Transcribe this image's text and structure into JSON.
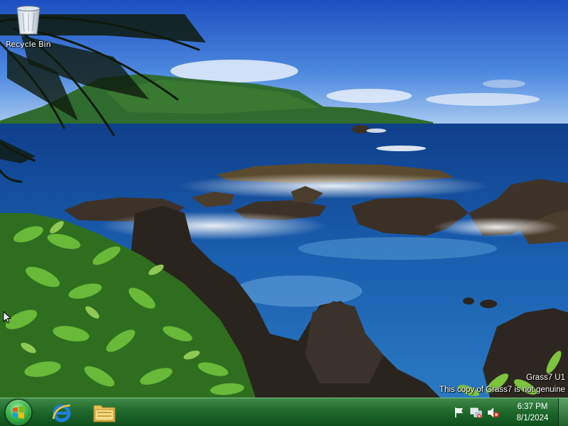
{
  "desktop": {
    "icons": [
      {
        "label": "Recycle Bin",
        "icon": "recycle-bin-icon"
      }
    ],
    "wallpaper": "tropical-coast-scene"
  },
  "watermark": {
    "line1": "Grass7 U1",
    "line2": "This copy of Grass7 is not genuine"
  },
  "taskbar": {
    "start_icon": "windows-logo-icon",
    "quick_launch": [
      {
        "name": "internet-explorer-icon"
      },
      {
        "name": "file-explorer-icon"
      }
    ],
    "tray_icons": [
      {
        "name": "action-center-flag-icon"
      },
      {
        "name": "network-icon"
      },
      {
        "name": "volume-muted-icon"
      }
    ],
    "clock": {
      "time": "6:37 PM",
      "date": "8/1/2024"
    }
  },
  "colors": {
    "taskbar": "#1f6a2c",
    "start_orb": "#39b54a",
    "sky": "#2c6fd6",
    "ocean": "#1a5fa8"
  }
}
